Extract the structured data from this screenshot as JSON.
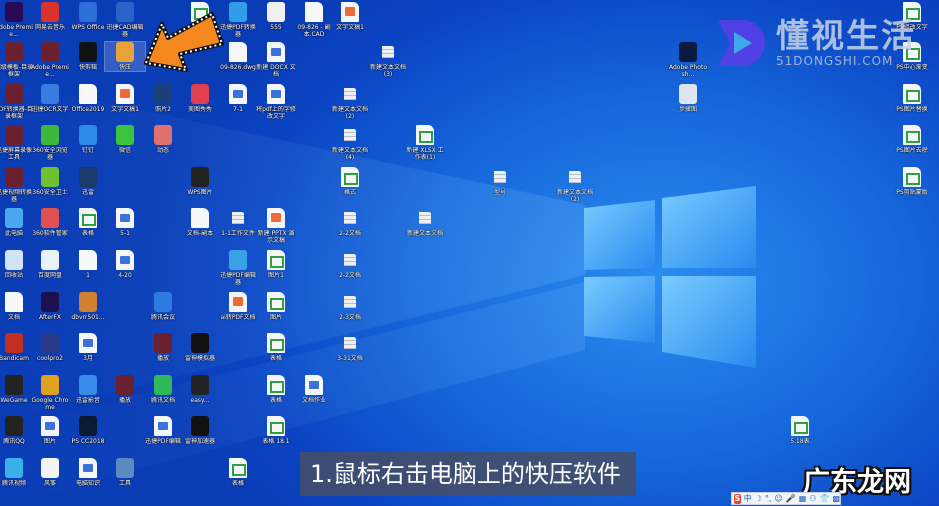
{
  "desktop": {
    "icons": [
      {
        "label": "Adobe Premie...",
        "type": "app",
        "color": "#2a0a55"
      },
      {
        "label": "网易云音乐",
        "type": "app",
        "color": "#d9312b"
      },
      {
        "label": "WPS Office",
        "type": "app",
        "color": "#2d6ed8"
      },
      {
        "label": "迅捷CAD编辑器",
        "type": "app",
        "color": "#2a62c8"
      },
      {
        "label": "",
        "type": "xls"
      },
      {
        "label": "迅捷PDF转换器",
        "type": "app",
        "color": "#2f9de8"
      },
      {
        "label": "555",
        "type": "app",
        "color": "#f0f0f0"
      },
      {
        "label": "09-826 - 副本.CAD",
        "type": "file"
      },
      {
        "label": "文字文稿1",
        "type": "ppt"
      },
      {
        "label": "超级模板-目录框架",
        "type": "app",
        "color": "#6b2030"
      },
      {
        "label": "Adobe Premie...",
        "type": "app",
        "color": "#6b2030"
      },
      {
        "label": "快剪辑",
        "type": "app",
        "color": "#111"
      },
      {
        "label": "快压",
        "type": "app",
        "color": "#e8a33a",
        "selected": true
      },
      {
        "label": "09-826.dwg",
        "type": "file"
      },
      {
        "label": "新建 DOCX 文档",
        "type": "doc"
      },
      {
        "label": "新建文本文档(3)",
        "type": "txt"
      },
      {
        "label": "PDF转换器-目录框架",
        "type": "app",
        "color": "#6b2030"
      },
      {
        "label": "迅捷OCR文字",
        "type": "app",
        "color": "#3a7be0"
      },
      {
        "label": "Office2019",
        "type": "file"
      },
      {
        "label": "文字文稿1",
        "type": "ppt"
      },
      {
        "label": "照片2",
        "type": "app",
        "color": "#1a3e7a"
      },
      {
        "label": "美图秀秀",
        "type": "app",
        "color": "#e04050"
      },
      {
        "label": "7-1",
        "type": "doc"
      },
      {
        "label": "将pdf上的字修改文字",
        "type": "doc"
      },
      {
        "label": "新建文本文档(2)",
        "type": "txt"
      },
      {
        "label": "迅捷屏幕录像工具",
        "type": "app",
        "color": "#6b2030"
      },
      {
        "label": "360安全浏览器",
        "type": "app",
        "color": "#3cb83c"
      },
      {
        "label": "钉钉",
        "type": "app",
        "color": "#2a8ae8"
      },
      {
        "label": "微信",
        "type": "app",
        "color": "#3cc43c"
      },
      {
        "label": "动态",
        "type": "app",
        "color": "#e07070"
      },
      {
        "label": "新建文本文档(4)",
        "type": "txt"
      },
      {
        "label": "新建 XLSX 工作表(1)",
        "type": "xls"
      },
      {
        "label": "迅捷视频转换器",
        "type": "app",
        "color": "#6b2030"
      },
      {
        "label": "360安全卫士",
        "type": "app",
        "color": "#70c030"
      },
      {
        "label": "迅雷",
        "type": "app",
        "color": "#1a3a6a"
      },
      {
        "label": "WPS图片",
        "type": "app",
        "color": "#222"
      },
      {
        "label": "格式",
        "type": "xls"
      },
      {
        "label": "型号",
        "type": "txt"
      },
      {
        "label": "新建文本文档(2)",
        "type": "txt"
      },
      {
        "label": "此电脑",
        "type": "app",
        "color": "#4aa8f0"
      },
      {
        "label": "360软件管家",
        "type": "app",
        "color": "#e05050"
      },
      {
        "label": "表格",
        "type": "xls"
      },
      {
        "label": "5-1",
        "type": "doc"
      },
      {
        "label": "文档-副本",
        "type": "file"
      },
      {
        "label": "1-1工作文件",
        "type": "txt"
      },
      {
        "label": "新建 PPTX 演示文稿",
        "type": "ppt"
      },
      {
        "label": "2-2文档",
        "type": "txt"
      },
      {
        "label": "新建文本文档",
        "type": "txt"
      },
      {
        "label": "回收站",
        "type": "app",
        "color": "#cfe4f8"
      },
      {
        "label": "百度网盘",
        "type": "app",
        "color": "#eaf2fc"
      },
      {
        "label": "1",
        "type": "file"
      },
      {
        "label": "4-20",
        "type": "doc"
      },
      {
        "label": "迅捷PDF编辑器",
        "type": "app",
        "color": "#3aa0e8"
      },
      {
        "label": "图片1",
        "type": "xls"
      },
      {
        "label": "2-2文档",
        "type": "txt"
      },
      {
        "label": "文档",
        "type": "file"
      },
      {
        "label": "AfterFX",
        "type": "app",
        "color": "#1c1050"
      },
      {
        "label": "dbvrr501...",
        "type": "app",
        "color": "#d08030"
      },
      {
        "label": "腾讯会议",
        "type": "app",
        "color": "#2a7ae0"
      },
      {
        "label": "ai转PDF文档",
        "type": "ppt"
      },
      {
        "label": "图片",
        "type": "xls"
      },
      {
        "label": "2-3文档",
        "type": "txt"
      },
      {
        "label": "Bandicam",
        "type": "app",
        "color": "#c03020"
      },
      {
        "label": "coolpro2",
        "type": "app",
        "color": "#2a3a8a"
      },
      {
        "label": "3月",
        "type": "doc"
      },
      {
        "label": "播放",
        "type": "app",
        "color": "#6b2030"
      },
      {
        "label": "雷神模拟器",
        "type": "app",
        "color": "#111"
      },
      {
        "label": "表格",
        "type": "xls"
      },
      {
        "label": "3-31文档",
        "type": "txt"
      },
      {
        "label": "WeGame",
        "type": "app",
        "color": "#222"
      },
      {
        "label": "Google Chrome",
        "type": "app",
        "color": "#e0a020"
      },
      {
        "label": "迅雷影音",
        "type": "app",
        "color": "#3a8ae8"
      },
      {
        "label": "播放",
        "type": "app",
        "color": "#6b2030"
      },
      {
        "label": "腾讯文档",
        "type": "app",
        "color": "#2eb85a"
      },
      {
        "label": "easy...",
        "type": "app",
        "color": "#222"
      },
      {
        "label": "表格",
        "type": "xls"
      },
      {
        "label": "文档作业",
        "type": "doc"
      },
      {
        "label": "腾讯QQ",
        "type": "app",
        "color": "#222"
      },
      {
        "label": "图片",
        "type": "doc"
      },
      {
        "label": "PS CC2018",
        "type": "app",
        "color": "#0a1a30"
      },
      {
        "label": "迅捷PDF编辑",
        "type": "doc"
      },
      {
        "label": "雷神加速器",
        "type": "app",
        "color": "#111"
      },
      {
        "label": "表格 18.1",
        "type": "xls"
      },
      {
        "label": "5.18表",
        "type": "xls"
      },
      {
        "label": "腾讯视频",
        "type": "app",
        "color": "#3ab0e8"
      },
      {
        "label": "风筝",
        "type": "app",
        "color": "#f4f4f4"
      },
      {
        "label": "电脑知识",
        "type": "doc"
      },
      {
        "label": "工具",
        "type": "app",
        "color": "#5a8ac0"
      },
      {
        "label": "表格",
        "type": "xls"
      },
      {
        "label": "Adobe Photosh...",
        "type": "app",
        "color": "#0a1a40"
      },
      {
        "label": "步骤图",
        "type": "app",
        "color": "#dde6f0"
      },
      {
        "label": "PS修改文字",
        "type": "xls"
      },
      {
        "label": "PS中心渐变",
        "type": "xls"
      },
      {
        "label": "PS图片替换",
        "type": "xls"
      },
      {
        "label": "PS图片去除",
        "type": "xls"
      },
      {
        "label": "PS剪贴蒙版",
        "type": "xls"
      }
    ]
  },
  "subtitle": "1.鼠标右击电脑上的快压软件",
  "watermark": {
    "brand": "懂视生活",
    "domain": "51DONGSHI.COM"
  },
  "corner_logo": "广东龙网",
  "ime": {
    "logo": "S",
    "mode": "中",
    "items": [
      "☽",
      "°,",
      "☺",
      "🎤",
      "▦",
      "⚇",
      "👕",
      "▩"
    ]
  }
}
